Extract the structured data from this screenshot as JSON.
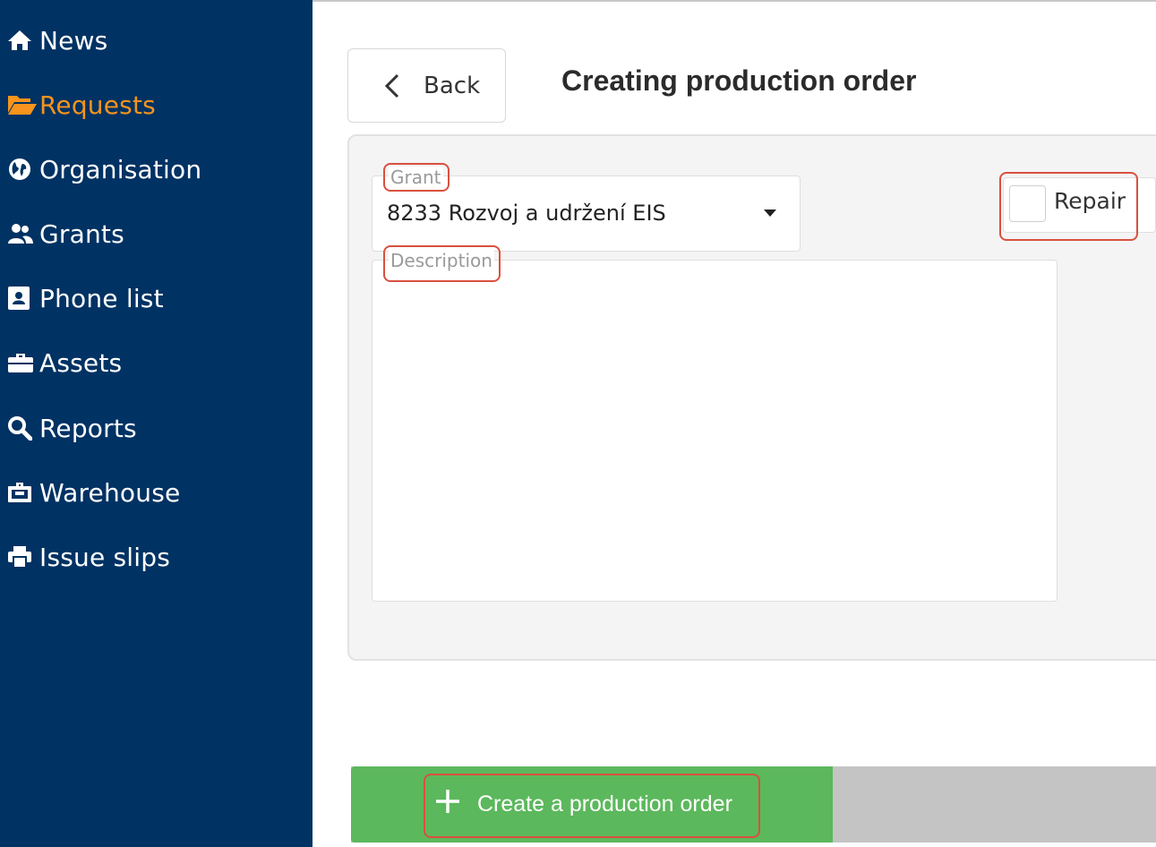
{
  "sidebar": {
    "items": [
      {
        "label": "News",
        "icon": "home-icon",
        "active": false
      },
      {
        "label": "Requests",
        "icon": "folder-open-icon",
        "active": true
      },
      {
        "label": "Organisation",
        "icon": "globe-icon",
        "active": false
      },
      {
        "label": "Grants",
        "icon": "users-icon",
        "active": false
      },
      {
        "label": "Phone list",
        "icon": "contact-card-icon",
        "active": false
      },
      {
        "label": "Assets",
        "icon": "toolbox-icon",
        "active": false
      },
      {
        "label": "Reports",
        "icon": "search-icon",
        "active": false
      },
      {
        "label": "Warehouse",
        "icon": "warehouse-icon",
        "active": false
      },
      {
        "label": "Issue slips",
        "icon": "printer-icon",
        "active": false
      }
    ],
    "bg_color": "#003263",
    "active_color": "#f7941d"
  },
  "header": {
    "back_label": "Back",
    "title": "Creating production order"
  },
  "form": {
    "grant": {
      "label": "Grant",
      "value": "8233 Rozvoj a udržení EIS"
    },
    "description": {
      "label": "Description",
      "value": ""
    },
    "repair": {
      "label": "Repair",
      "checked": false
    }
  },
  "actions": {
    "create_label": "Create a production order",
    "create_color": "#5cb85c"
  },
  "highlight_color": "#d9503f"
}
